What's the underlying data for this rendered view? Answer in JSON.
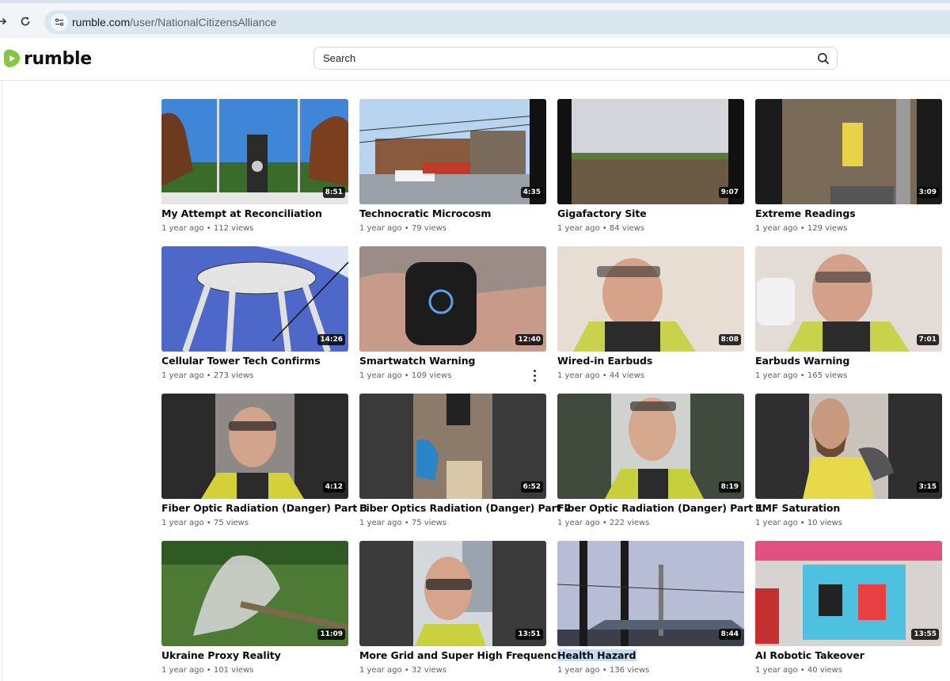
{
  "browser": {
    "url_host": "rumble.com",
    "url_path": "/user/NationalCitizensAlliance"
  },
  "header": {
    "logo_text": "rumble",
    "search_placeholder": "Search"
  },
  "colors": {
    "brand_green": "#85c742",
    "highlight": "#c5dcf3"
  },
  "videos": [
    {
      "title": "My Attempt at Reconciliation",
      "meta": "1 year ago • 112 views",
      "duration": "8:51"
    },
    {
      "title": "Technocratic Microcosm",
      "meta": "1 year ago • 79 views",
      "duration": "4:35"
    },
    {
      "title": "Gigafactory Site",
      "meta": "1 year ago • 84 views",
      "duration": "9:07"
    },
    {
      "title": "Extreme Readings",
      "meta": "1 year ago • 129 views",
      "duration": "3:09"
    },
    {
      "title": "Cellular Tower Tech Confirms",
      "meta": "1 year ago • 273 views",
      "duration": "14:26"
    },
    {
      "title": "Smartwatch Warning",
      "meta": "1 year ago • 109 views",
      "duration": "12:40"
    },
    {
      "title": "Wired-in Earbuds",
      "meta": "1 year ago • 44 views",
      "duration": "8:08"
    },
    {
      "title": "Earbuds Warning",
      "meta": "1 year ago • 165 views",
      "duration": "7:01"
    },
    {
      "title": "Fiber Optic Radiation (Danger) Part 3",
      "meta": "1 year ago • 75 views",
      "duration": "4:12"
    },
    {
      "title": "Fiber Optics Radiation (Danger) Part 2",
      "meta": "1 year ago • 75 views",
      "duration": "6:52"
    },
    {
      "title": "Fiber Optic Radiation (Danger) Part 1",
      "meta": "1 year ago • 222 views",
      "duration": "8:19"
    },
    {
      "title": "EMF Saturation",
      "meta": "1 year ago • 10 views",
      "duration": "3:15"
    },
    {
      "title": "Ukraine Proxy Reality",
      "meta": "1 year ago • 101 views",
      "duration": "11:09"
    },
    {
      "title": "More Grid and Super High Frequency",
      "meta": "1 year ago • 32 views",
      "duration": "13:51"
    },
    {
      "title": "Health Hazard",
      "meta": "1 year ago • 136 views",
      "duration": "8:44"
    },
    {
      "title": "AI Robotic Takeover",
      "meta": "1 year ago • 40 views",
      "duration": "13:55"
    }
  ]
}
